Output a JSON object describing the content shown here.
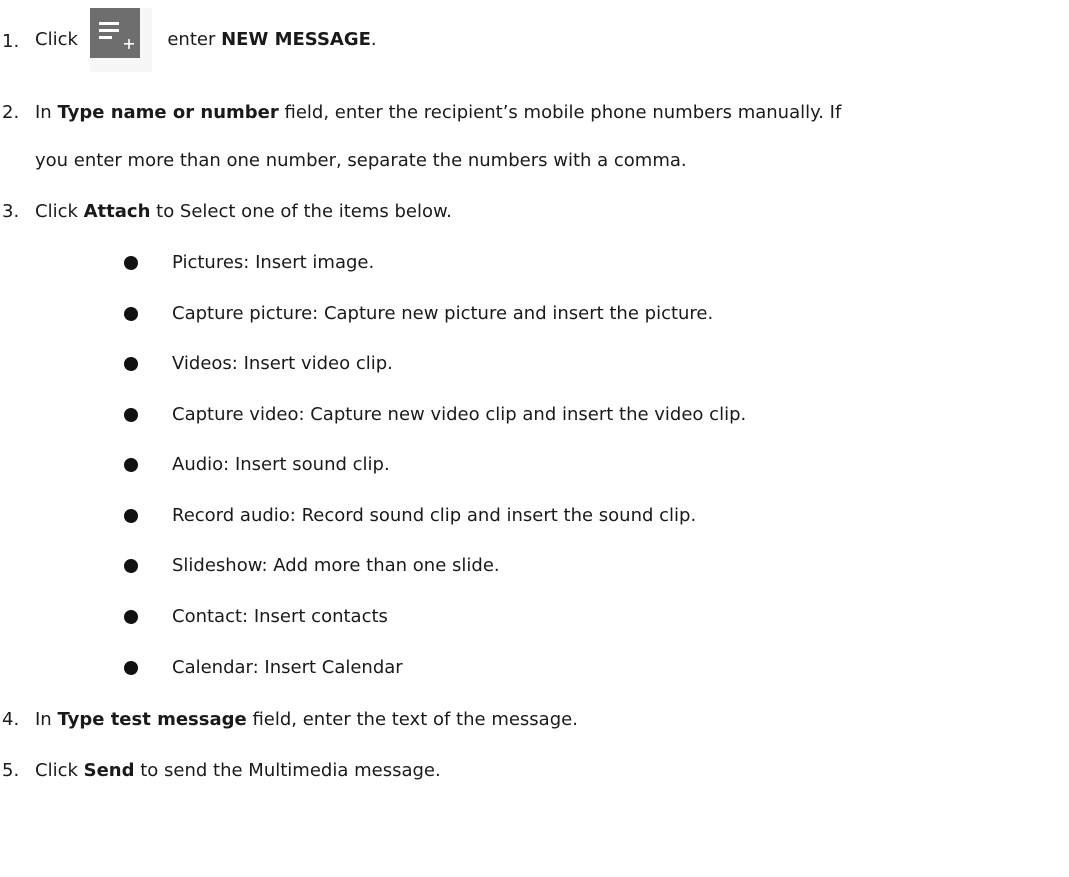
{
  "steps": [
    {
      "number": "1.",
      "pre": "Click",
      "icon": "new-message-icon",
      "mid": "enter",
      "bold": "NEW MESSAGE",
      "post": "."
    },
    {
      "number": "2.",
      "pre": "In",
      "bold": "Type name or number",
      "post": "field, enter the recipient’s mobile phone numbers manually. If",
      "continuation": "you enter more than one number, separate the numbers with a comma."
    },
    {
      "number": "3.",
      "pre": "Click",
      "bold": "Attach",
      "post": "to Select one of the items below."
    },
    {
      "number": "4.",
      "pre": "In",
      "bold": "Type test message",
      "post": "field, enter the text of the message."
    },
    {
      "number": "5.",
      "pre": "Click",
      "bold": "Send",
      "post": "to send the Multimedia message."
    }
  ],
  "attach_items": [
    "Pictures: Insert image.",
    "Capture picture: Capture new picture and insert the picture.",
    "Videos: Insert video clip.",
    "Capture video: Capture new video clip and insert the video clip.",
    "Audio: Insert sound clip.",
    "Record audio: Record sound clip and insert the sound clip.",
    "Slideshow: Add more than one slide.",
    "Contact: Insert contacts",
    "Calendar: Insert Calendar"
  ],
  "colors": {
    "text": "#1a1a1a",
    "icon_tile": "#6e6e6e",
    "icon_glyph": "#ffffff"
  }
}
